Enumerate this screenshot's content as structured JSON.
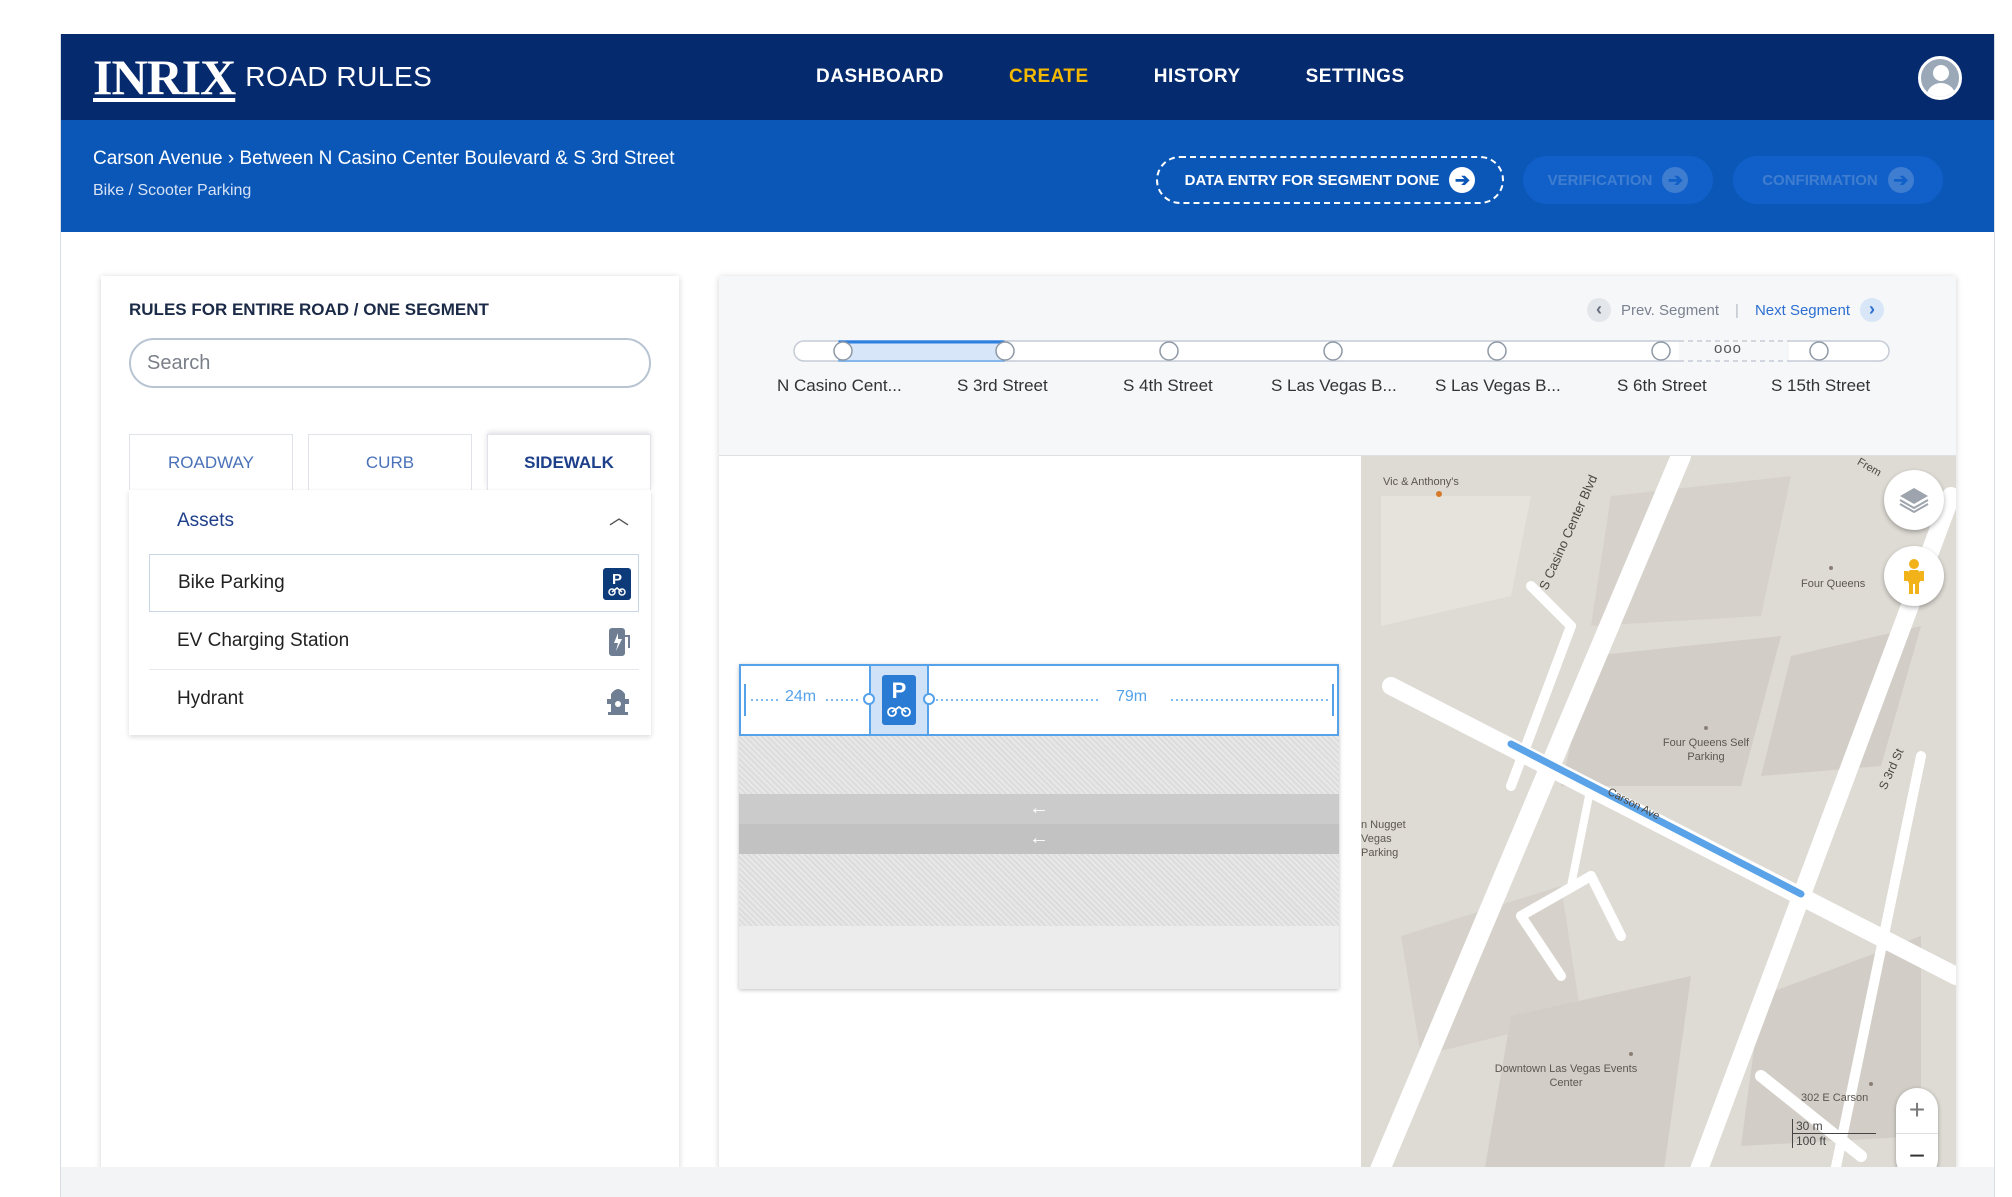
{
  "header": {
    "logo_mark": "INRIX",
    "logo_sub": "ROAD RULES",
    "nav": [
      {
        "label": "DASHBOARD",
        "active": false
      },
      {
        "label": "CREATE",
        "active": true
      },
      {
        "label": "HISTORY",
        "active": false
      },
      {
        "label": "SETTINGS",
        "active": false
      }
    ]
  },
  "subheader": {
    "breadcrumb": "Carson Avenue › Between N Casino Center Boulevard & S 3rd Street",
    "subtitle": "Bike / Scooter Parking",
    "steps": [
      {
        "label": "DATA ENTRY FOR SEGMENT DONE",
        "state": "current"
      },
      {
        "label": "VERIFICATION",
        "state": "disabled"
      },
      {
        "label": "CONFIRMATION",
        "state": "disabled"
      }
    ]
  },
  "left_panel": {
    "title": "RULES FOR ENTIRE ROAD / ONE SEGMENT",
    "search_placeholder": "Search",
    "tabs": [
      {
        "label": "ROADWAY",
        "active": false
      },
      {
        "label": "CURB",
        "active": false
      },
      {
        "label": "SIDEWALK",
        "active": true
      }
    ],
    "assets": {
      "heading": "Assets",
      "items": [
        {
          "label": "Bike Parking",
          "icon": "bike-parking-icon",
          "selected": true
        },
        {
          "label": "EV Charging Station",
          "icon": "ev-charging-icon",
          "selected": false
        },
        {
          "label": "Hydrant",
          "icon": "hydrant-icon",
          "selected": false
        }
      ]
    }
  },
  "segment_nav": {
    "prev_label": "Prev. Segment",
    "separator": "|",
    "next_label": "Next Segment",
    "segments": [
      "N Casino Cent...",
      "S 3rd Street",
      "S 4th Street",
      "S Las Vegas B...",
      "S Las Vegas B...",
      "S 6th Street",
      "S 15th Street"
    ],
    "more": "ooo"
  },
  "road_editor": {
    "dist_left": "24m",
    "dist_right": "79m",
    "parking_glyph": "P",
    "arrow": "←"
  },
  "map": {
    "labels": {
      "vic": "Vic & Anthony's",
      "four_queens": "Four Queens",
      "four_queens_parking": "Four Queens Self Parking",
      "nugget": "n Nugget Vegas Parking",
      "downtown": "Downtown Las Vegas Events Center",
      "carson302": "302 E Carson",
      "casino_center": "S Casino Center Blvd",
      "third_st": "S 3rd St",
      "carson": "Carson Ave",
      "fremont": "Frem"
    },
    "scale_m": "30 m",
    "scale_ft": "100 ft",
    "zoom_in": "+",
    "zoom_out": "−",
    "route_color": "#5ba3e8"
  },
  "colors": {
    "topbar": "#062a6e",
    "subbar": "#0a57b8",
    "accent": "#f5b800",
    "selection": "#55a2ea"
  }
}
